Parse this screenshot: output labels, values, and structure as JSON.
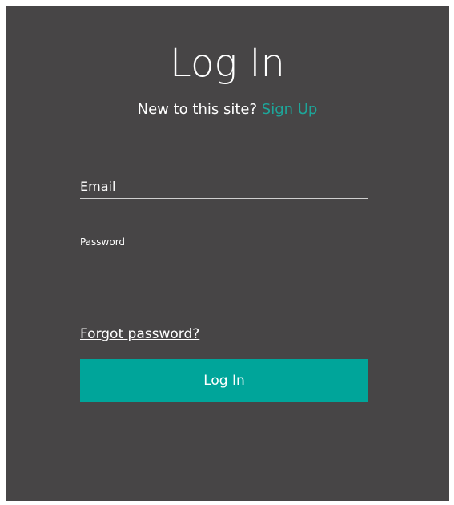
{
  "dialog": {
    "title": "Log In",
    "subtitle_prefix": "New to this site?",
    "signup_label": "Sign Up"
  },
  "form": {
    "email_label": "Email",
    "email_value": "",
    "password_label": "Password",
    "password_value": "",
    "forgot_label": "Forgot password?",
    "submit_label": "Log In"
  },
  "colors": {
    "panel_background": "#474546",
    "accent": "#00a59a",
    "link_accent": "#1da69a",
    "text": "#ffffff"
  }
}
